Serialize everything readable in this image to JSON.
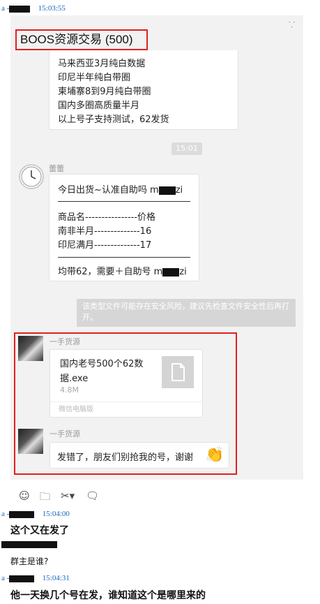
{
  "top_log": {
    "prefix": "a -",
    "time": "15:03:55"
  },
  "chat": {
    "pin_icon": "pin-icon",
    "group_title": "BOOS资源交易 (500)",
    "first_bubble": {
      "lines": [
        "马来西亚3月纯白数据",
        "印尼半年纯白带圈",
        "柬埔寨8到9月纯白带圈",
        "国内多圈高质量半月",
        "以上号子支持测试，62发货"
      ]
    },
    "time_divider": "15:01",
    "msg1": {
      "sender": "蕾蕾",
      "line1_prefix": "今日出货~认准自助吗 m",
      "line1_suffix": "zi",
      "header": "商品名----------------价格",
      "row1": "南非半月--------------16",
      "row2": "印尼满月--------------17",
      "footer_prefix": "均带62，需要＋自助号 m",
      "footer_suffix": "zi"
    },
    "warning": "该类型文件可能存在安全风险，建议先检查文件安全性后再打开。",
    "msg2": {
      "sender": "一手货源",
      "file_name": "国内老号500个62数据.exe",
      "file_size": "4.8M",
      "file_source": "微信电脑版"
    },
    "msg3": {
      "sender": "一手货源",
      "text": "发错了，朋友们别抢我的号，谢谢",
      "emoji_icon": "clap-hands-icon"
    },
    "toolbar_icons": [
      "emoji-icon",
      "folder-icon",
      "scissors-icon",
      "chat-bubble-icon"
    ]
  },
  "log": [
    {
      "prefix": "a -",
      "time": "15:04:00",
      "text": "这个又在发了"
    },
    {
      "prefix": "",
      "time": "",
      "text": "群主是谁?"
    },
    {
      "prefix": "a -",
      "time": "15:04:31",
      "text": "他一天换几个号在发，谁知道这个是哪里来的"
    }
  ],
  "colors": {
    "highlight": "#e02020",
    "log_blue": "#1565c0",
    "panel": "#f2f2f2"
  }
}
